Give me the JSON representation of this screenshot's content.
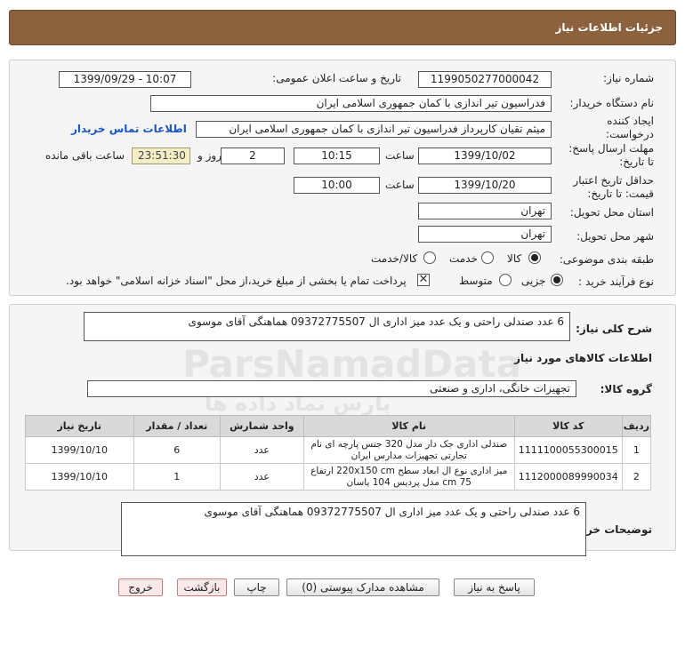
{
  "header": {
    "title": "جزئیات اطلاعات نیاز"
  },
  "form": {
    "need_number_label": "شماره نیاز:",
    "need_number": "1199050277000042",
    "announce_label": "تاریخ و ساعت اعلان عمومی:",
    "announce_value": "1399/09/29 - 10:07",
    "buyer_org_label": "نام دستگاه خریدار:",
    "buyer_org": "فدراسیون تیر اندازی با کمان جمهوری اسلامی ایران",
    "creator_label": "ایجاد کننده درخواست:",
    "creator": "میثم تقیان کارپرداز فدراسیون تیر اندازی با کمان جمهوری اسلامی ایران",
    "contact_link": "اطلاعات تماس خریدار",
    "deadline_label": "مهلت ارسال پاسخ: تا تاریخ:",
    "deadline_date": "1399/10/02",
    "time_label": "ساعت",
    "deadline_time": "10:15",
    "days_count": "2",
    "days_label": "روز و",
    "remaining_timer": "23:51:30",
    "remaining_label": "ساعت باقی مانده",
    "validity_label": "حداقل تاریخ اعتبار قیمت: تا تاریخ:",
    "validity_date": "1399/10/20",
    "validity_time": "10:00",
    "province_label": "استان محل تحویل:",
    "province": "تهران",
    "city_label": "شهر محل تحویل:",
    "city": "تهران",
    "category_label": "طبقه بندی موضوعی:",
    "category_options": [
      "کالا",
      "خدمت",
      "کالا/خدمت"
    ],
    "process_label": "نوع فرآیند خرید :",
    "process_options": [
      "جزیی",
      "متوسط"
    ],
    "payment_note": "پرداخت تمام یا بخشی از مبلغ خرید،از محل \"اسناد خزانه اسلامی\" خواهد بود."
  },
  "summary": {
    "label": "شرح کلی نیاز:",
    "text": "6 عدد صندلی راحتی و یک عدد میز اداری ال 09372775507 هماهنگی آقای موسوی"
  },
  "items_section": {
    "title": "اطلاعات کالاهای مورد نیاز",
    "group_label": "گروه کالا:",
    "group_value": "تجهیزات خانگی، اداری و صنعتی"
  },
  "table": {
    "headers": [
      "ردیف",
      "کد کالا",
      "نام کالا",
      "واحد شمارش",
      "تعداد / مقدار",
      "تاریخ نیاز"
    ],
    "rows": [
      {
        "row": "1",
        "code": "1111100055300015",
        "name": "صندلی اداری جک دار مدل 320 جنس پارچه ای نام تجارتی تجهیزات مدارس ایران",
        "unit": "عدد",
        "qty": "6",
        "date": "1399/10/10"
      },
      {
        "row": "2",
        "code": "1112000089990034",
        "name": "میز اداری نوع ال ابعاد سطح 220x150 cm ارتفاع 75 cm مدل پردیس 104 یاسان",
        "unit": "عدد",
        "qty": "1",
        "date": "1399/10/10"
      }
    ]
  },
  "buyer_notes": {
    "label": "توضیحات خریدار:",
    "text": "6 عدد صندلی راحتی و یک عدد میز اداری ال 09372775507 هماهنگی آقای موسوی"
  },
  "buttons": {
    "reply": "پاسخ به نیاز",
    "attachments": "مشاهده مدارک پیوستی (0)",
    "print": "چاپ",
    "back": "بازگشت",
    "exit": "خروج"
  },
  "watermark": {
    "brand": "ParsNamadData",
    "sub": "پارس نماد داده ها"
  }
}
